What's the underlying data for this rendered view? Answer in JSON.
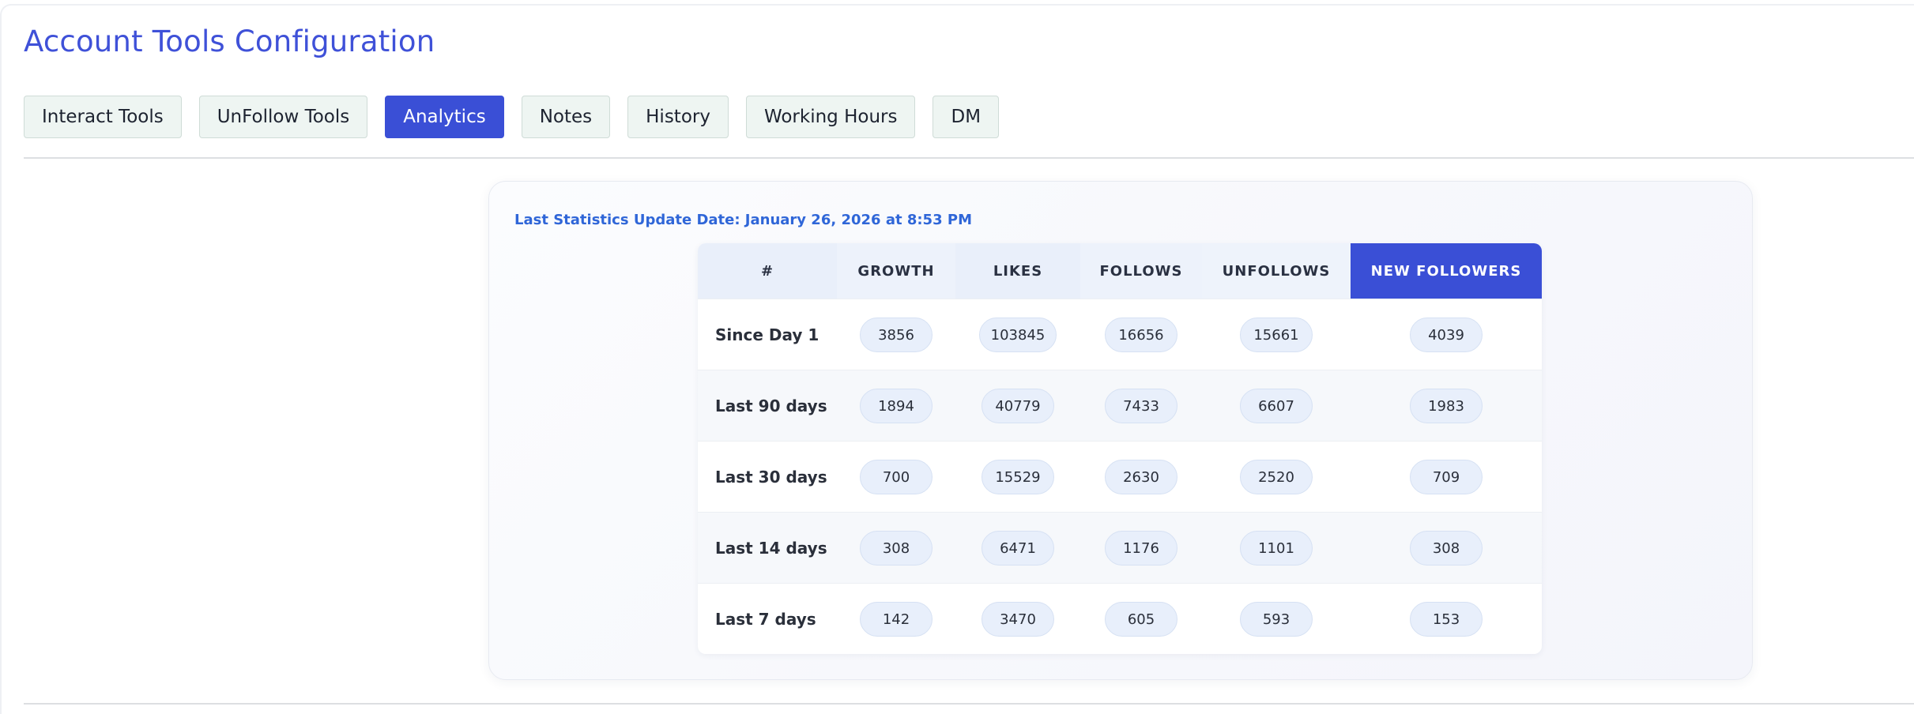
{
  "title": "Account Tools Configuration",
  "tabs": [
    {
      "label": "Interact Tools",
      "active": false
    },
    {
      "label": "UnFollow Tools",
      "active": false
    },
    {
      "label": "Analytics",
      "active": true
    },
    {
      "label": "Notes",
      "active": false
    },
    {
      "label": "History",
      "active": false
    },
    {
      "label": "Working Hours",
      "active": false
    },
    {
      "label": "DM",
      "active": false
    }
  ],
  "stats": {
    "update_label": "Last Statistics Update Date: January 26, 2026 at 8:53 PM",
    "columns": [
      "#",
      "GROWTH",
      "LIKES",
      "FOLLOWS",
      "UNFOLLOWS",
      "NEW FOLLOWERS"
    ],
    "rows": [
      {
        "label": "Since Day 1",
        "values": [
          "3856",
          "103845",
          "16656",
          "15661",
          "4039"
        ]
      },
      {
        "label": "Last 90 days",
        "values": [
          "1894",
          "40779",
          "7433",
          "6607",
          "1983"
        ]
      },
      {
        "label": "Last 30 days",
        "values": [
          "700",
          "15529",
          "2630",
          "2520",
          "709"
        ]
      },
      {
        "label": "Last 14 days",
        "values": [
          "308",
          "6471",
          "1176",
          "1101",
          "308"
        ]
      },
      {
        "label": "Last 7 days",
        "values": [
          "142",
          "3470",
          "605",
          "593",
          "153"
        ]
      }
    ]
  },
  "colors": {
    "accent": "#3a4fd6",
    "title": "#3f51d8",
    "update_date": "#2f66d8",
    "tab_bg": "#eef5f2",
    "pill_bg": "#e8effb"
  }
}
